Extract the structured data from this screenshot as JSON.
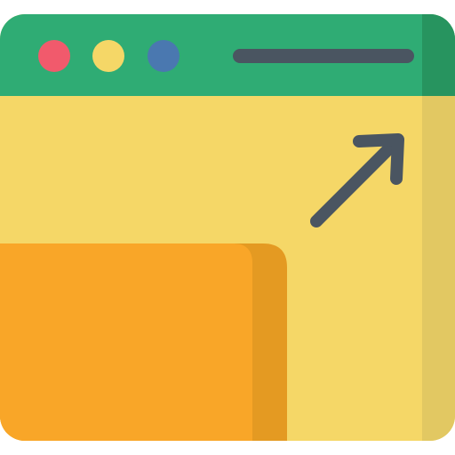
{
  "icon": {
    "name": "browser-window-maximize-icon",
    "colors": {
      "titlebar": "#2fac74",
      "titlebar_shade": "#27945f",
      "body": "#f5d767",
      "body_shade": "#e2c862",
      "panel": "#f9a628",
      "panel_shade": "#e49a22",
      "dot_close": "#f15a6c",
      "dot_minimize": "#f5d767",
      "dot_maximize": "#4a78b0",
      "bar": "#4a5561",
      "arrow": "#4a5561"
    }
  }
}
